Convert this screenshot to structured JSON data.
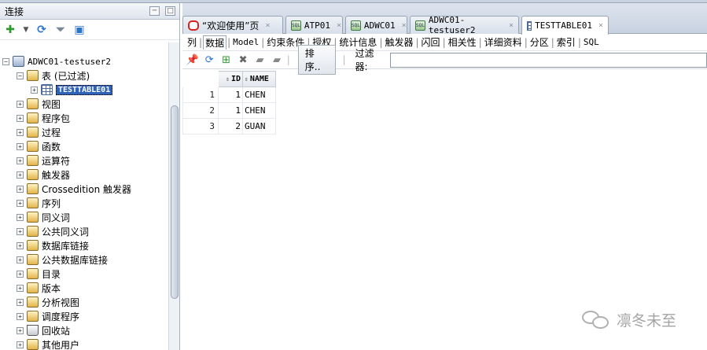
{
  "connections_panel": {
    "title": "连接",
    "tree": [
      {
        "label": "ADWC01-testuser2",
        "depth": 0,
        "icon": "database-connection-icon",
        "expanded": true
      },
      {
        "label": "表 (已过滤)",
        "depth": 1,
        "icon": "table-folder-icon",
        "expanded": true
      },
      {
        "label": "TESTTABLE01",
        "depth": 2,
        "icon": "table-icon",
        "selected": true
      },
      {
        "label": "视图",
        "depth": 1,
        "icon": "view-icon"
      },
      {
        "label": "程序包",
        "depth": 1,
        "icon": "package-icon"
      },
      {
        "label": "过程",
        "depth": 1,
        "icon": "procedure-icon"
      },
      {
        "label": "函数",
        "depth": 1,
        "icon": "function-icon"
      },
      {
        "label": "运算符",
        "depth": 1,
        "icon": "operator-icon"
      },
      {
        "label": "触发器",
        "depth": 1,
        "icon": "trigger-icon"
      },
      {
        "label": "Crossedition 触发器",
        "depth": 1,
        "icon": "crossedition-trigger-icon"
      },
      {
        "label": "序列",
        "depth": 1,
        "icon": "sequence-icon"
      },
      {
        "label": "同义词",
        "depth": 1,
        "icon": "synonym-icon"
      },
      {
        "label": "公共同义词",
        "depth": 1,
        "icon": "public-synonym-icon"
      },
      {
        "label": "数据库链接",
        "depth": 1,
        "icon": "db-link-icon"
      },
      {
        "label": "公共数据库链接",
        "depth": 1,
        "icon": "public-db-link-icon"
      },
      {
        "label": "目录",
        "depth": 1,
        "icon": "directory-icon"
      },
      {
        "label": "版本",
        "depth": 1,
        "icon": "edition-icon"
      },
      {
        "label": "分析视图",
        "depth": 1,
        "icon": "analytic-view-icon"
      },
      {
        "label": "调度程序",
        "depth": 1,
        "icon": "scheduler-icon"
      },
      {
        "label": "回收站",
        "depth": 1,
        "icon": "recycle-bin-icon"
      },
      {
        "label": "其他用户",
        "depth": 1,
        "icon": "other-users-icon"
      }
    ]
  },
  "doc_tabs": [
    {
      "label": "“欢迎使用”页",
      "icon": "oracle-icon"
    },
    {
      "label": "ATP01",
      "icon": "sql-worksheet-icon"
    },
    {
      "label": "ADWC01",
      "icon": "sql-worksheet-icon"
    },
    {
      "label": "ADWC01-testuser2",
      "icon": "sql-worksheet-icon"
    },
    {
      "label": "TESTTABLE01",
      "icon": "table-icon",
      "active": true
    }
  ],
  "sub_tabs": [
    "列",
    "数据",
    "Model",
    "约束条件",
    "授权",
    "统计信息",
    "触发器",
    "闪回",
    "相关性",
    "详细资料",
    "分区",
    "索引",
    "SQL"
  ],
  "active_sub_tab": "数据",
  "content_toolbar": {
    "sort_label": "排序..",
    "filter_label": "过滤器:",
    "filter_value": ""
  },
  "grid": {
    "columns": [
      "ID",
      "NAME"
    ],
    "rows": [
      {
        "rownum": "1",
        "id": "1",
        "name": "CHEN"
      },
      {
        "rownum": "2",
        "id": "1",
        "name": "CHEN"
      },
      {
        "rownum": "3",
        "id": "2",
        "name": "GUAN"
      }
    ]
  },
  "watermark": {
    "text": "凛冬未至"
  }
}
